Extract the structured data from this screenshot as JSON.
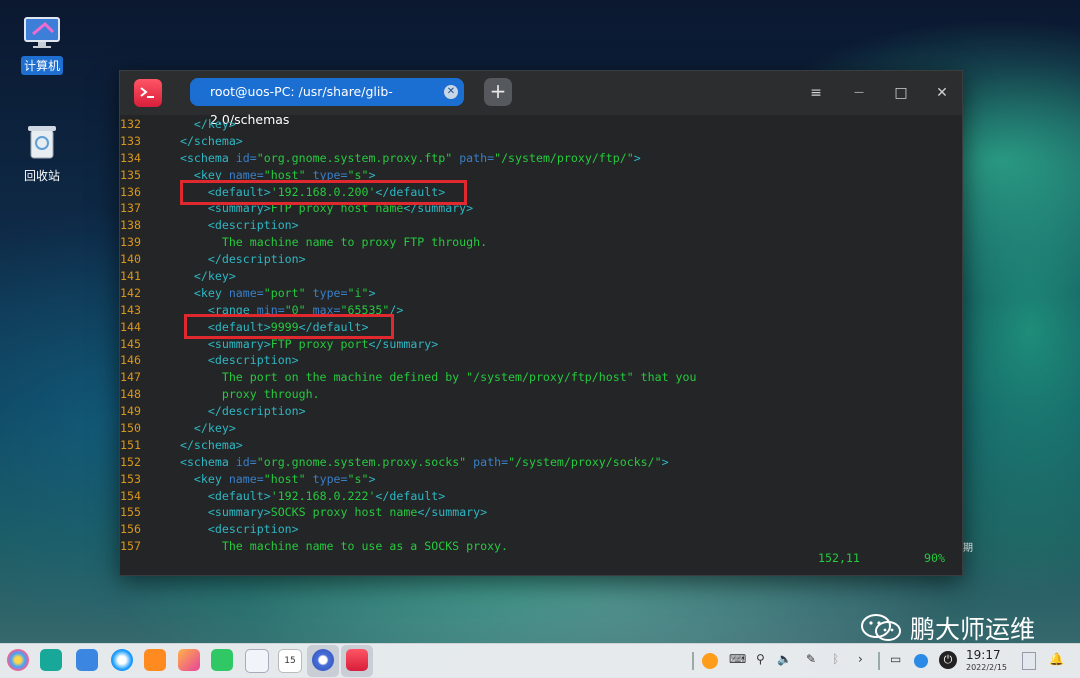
{
  "desktop": {
    "icons": [
      {
        "label": "计算机"
      },
      {
        "label": "回收站"
      }
    ],
    "partial_label": "期"
  },
  "terminal": {
    "tab_title": "root@uos-PC: /usr/share/glib-2.0/schemas",
    "add_tab": "+",
    "controls": {
      "menu": "≡",
      "minimize": "—",
      "maximize": "□",
      "close": "✕"
    },
    "lines": [
      {
        "num": "132",
        "segs": [
          {
            "t": "    ",
            "c": "text"
          },
          {
            "t": "</key>",
            "c": "tag"
          }
        ]
      },
      {
        "num": "133",
        "segs": [
          {
            "t": "  ",
            "c": "text"
          },
          {
            "t": "</schema>",
            "c": "tag"
          }
        ]
      },
      {
        "num": "134",
        "segs": [
          {
            "t": "  ",
            "c": "text"
          },
          {
            "t": "<schema ",
            "c": "tag"
          },
          {
            "t": "id=",
            "c": "attr"
          },
          {
            "t": "\"org.gnome.system.proxy.ftp\" ",
            "c": "val"
          },
          {
            "t": "path=",
            "c": "attr"
          },
          {
            "t": "\"/system/proxy/ftp/\"",
            "c": "val"
          },
          {
            "t": ">",
            "c": "tag"
          }
        ]
      },
      {
        "num": "135",
        "segs": [
          {
            "t": "    ",
            "c": "text"
          },
          {
            "t": "<key ",
            "c": "tag"
          },
          {
            "t": "name=",
            "c": "attr"
          },
          {
            "t": "\"host\" ",
            "c": "val"
          },
          {
            "t": "type=",
            "c": "attr"
          },
          {
            "t": "\"s\"",
            "c": "val"
          },
          {
            "t": ">",
            "c": "tag"
          }
        ]
      },
      {
        "num": "136",
        "segs": [
          {
            "t": "      ",
            "c": "text"
          },
          {
            "t": "<default>",
            "c": "tag"
          },
          {
            "t": "'192.168.0.200'",
            "c": "val"
          },
          {
            "t": "</default>",
            "c": "tag"
          }
        ]
      },
      {
        "num": "137",
        "segs": [
          {
            "t": "      ",
            "c": "text"
          },
          {
            "t": "<summary>",
            "c": "tag"
          },
          {
            "t": "FTP proxy host name",
            "c": "text"
          },
          {
            "t": "</summary>",
            "c": "tag"
          }
        ]
      },
      {
        "num": "138",
        "segs": [
          {
            "t": "      ",
            "c": "text"
          },
          {
            "t": "<description>",
            "c": "tag"
          }
        ]
      },
      {
        "num": "139",
        "segs": [
          {
            "t": "        The machine name to proxy FTP through.",
            "c": "text"
          }
        ]
      },
      {
        "num": "140",
        "segs": [
          {
            "t": "      ",
            "c": "text"
          },
          {
            "t": "</description>",
            "c": "tag"
          }
        ]
      },
      {
        "num": "141",
        "segs": [
          {
            "t": "    ",
            "c": "text"
          },
          {
            "t": "</key>",
            "c": "tag"
          }
        ]
      },
      {
        "num": "142",
        "segs": [
          {
            "t": "    ",
            "c": "text"
          },
          {
            "t": "<key ",
            "c": "tag"
          },
          {
            "t": "name=",
            "c": "attr"
          },
          {
            "t": "\"port\" ",
            "c": "val"
          },
          {
            "t": "type=",
            "c": "attr"
          },
          {
            "t": "\"i\"",
            "c": "val"
          },
          {
            "t": ">",
            "c": "tag"
          }
        ]
      },
      {
        "num": "143",
        "segs": [
          {
            "t": "      ",
            "c": "text"
          },
          {
            "t": "<range ",
            "c": "tag"
          },
          {
            "t": "min=",
            "c": "attr"
          },
          {
            "t": "\"0\" ",
            "c": "val"
          },
          {
            "t": "max=",
            "c": "attr"
          },
          {
            "t": "\"65535\"",
            "c": "val"
          },
          {
            "t": "/>",
            "c": "tag"
          }
        ]
      },
      {
        "num": "144",
        "segs": [
          {
            "t": "      ",
            "c": "text"
          },
          {
            "t": "<default>",
            "c": "tag"
          },
          {
            "t": "9999",
            "c": "val"
          },
          {
            "t": "</default>",
            "c": "tag"
          }
        ]
      },
      {
        "num": "145",
        "segs": [
          {
            "t": "      ",
            "c": "text"
          },
          {
            "t": "<summary>",
            "c": "tag"
          },
          {
            "t": "FTP proxy port",
            "c": "text"
          },
          {
            "t": "</summary>",
            "c": "tag"
          }
        ]
      },
      {
        "num": "146",
        "segs": [
          {
            "t": "      ",
            "c": "text"
          },
          {
            "t": "<description>",
            "c": "tag"
          }
        ]
      },
      {
        "num": "147",
        "segs": [
          {
            "t": "        The port on the machine defined by \"/system/proxy/ftp/host\" that you",
            "c": "text"
          }
        ]
      },
      {
        "num": "148",
        "segs": [
          {
            "t": "        proxy through.",
            "c": "text"
          }
        ]
      },
      {
        "num": "149",
        "segs": [
          {
            "t": "      ",
            "c": "text"
          },
          {
            "t": "</description>",
            "c": "tag"
          }
        ]
      },
      {
        "num": "150",
        "segs": [
          {
            "t": "    ",
            "c": "text"
          },
          {
            "t": "</key>",
            "c": "tag"
          }
        ]
      },
      {
        "num": "151",
        "segs": [
          {
            "t": "  ",
            "c": "text"
          },
          {
            "t": "</schema>",
            "c": "tag"
          }
        ]
      },
      {
        "num": "152",
        "segs": [
          {
            "t": "  ",
            "c": "text"
          },
          {
            "t": "<schema ",
            "c": "tag"
          },
          {
            "t": "id=",
            "c": "attr"
          },
          {
            "t": "\"org.gnome.system.proxy.socks\" ",
            "c": "val"
          },
          {
            "t": "path=",
            "c": "attr"
          },
          {
            "t": "\"/system/proxy/socks/\"",
            "c": "val"
          },
          {
            "t": ">",
            "c": "tag"
          }
        ]
      },
      {
        "num": "153",
        "segs": [
          {
            "t": "    ",
            "c": "text"
          },
          {
            "t": "<key ",
            "c": "tag"
          },
          {
            "t": "name=",
            "c": "attr"
          },
          {
            "t": "\"host\" ",
            "c": "val"
          },
          {
            "t": "type=",
            "c": "attr"
          },
          {
            "t": "\"s\"",
            "c": "val"
          },
          {
            "t": ">",
            "c": "tag"
          }
        ]
      },
      {
        "num": "154",
        "segs": [
          {
            "t": "      ",
            "c": "text"
          },
          {
            "t": "<default>",
            "c": "tag"
          },
          {
            "t": "'192.168.0.222'",
            "c": "val"
          },
          {
            "t": "</default>",
            "c": "tag"
          }
        ]
      },
      {
        "num": "155",
        "segs": [
          {
            "t": "      ",
            "c": "text"
          },
          {
            "t": "<summary>",
            "c": "tag"
          },
          {
            "t": "SOCKS proxy host name",
            "c": "text"
          },
          {
            "t": "</summary>",
            "c": "tag"
          }
        ]
      },
      {
        "num": "156",
        "segs": [
          {
            "t": "      ",
            "c": "text"
          },
          {
            "t": "<description>",
            "c": "tag"
          }
        ]
      },
      {
        "num": "157",
        "segs": [
          {
            "t": "        The machine name to use as a SOCKS proxy.",
            "c": "text"
          }
        ]
      }
    ],
    "status": {
      "position": "152,11",
      "percent": "90%"
    }
  },
  "taskbar": {
    "clock_time": "19:17",
    "clock_date": "2022/2/15",
    "calendar_day": "15"
  },
  "watermark": {
    "text": "鹏大师运维"
  },
  "colors": {
    "accent": "#1b6fd3",
    "highlight": "#e0282f",
    "line_number": "#d9971e",
    "code_green": "#27c93f"
  }
}
